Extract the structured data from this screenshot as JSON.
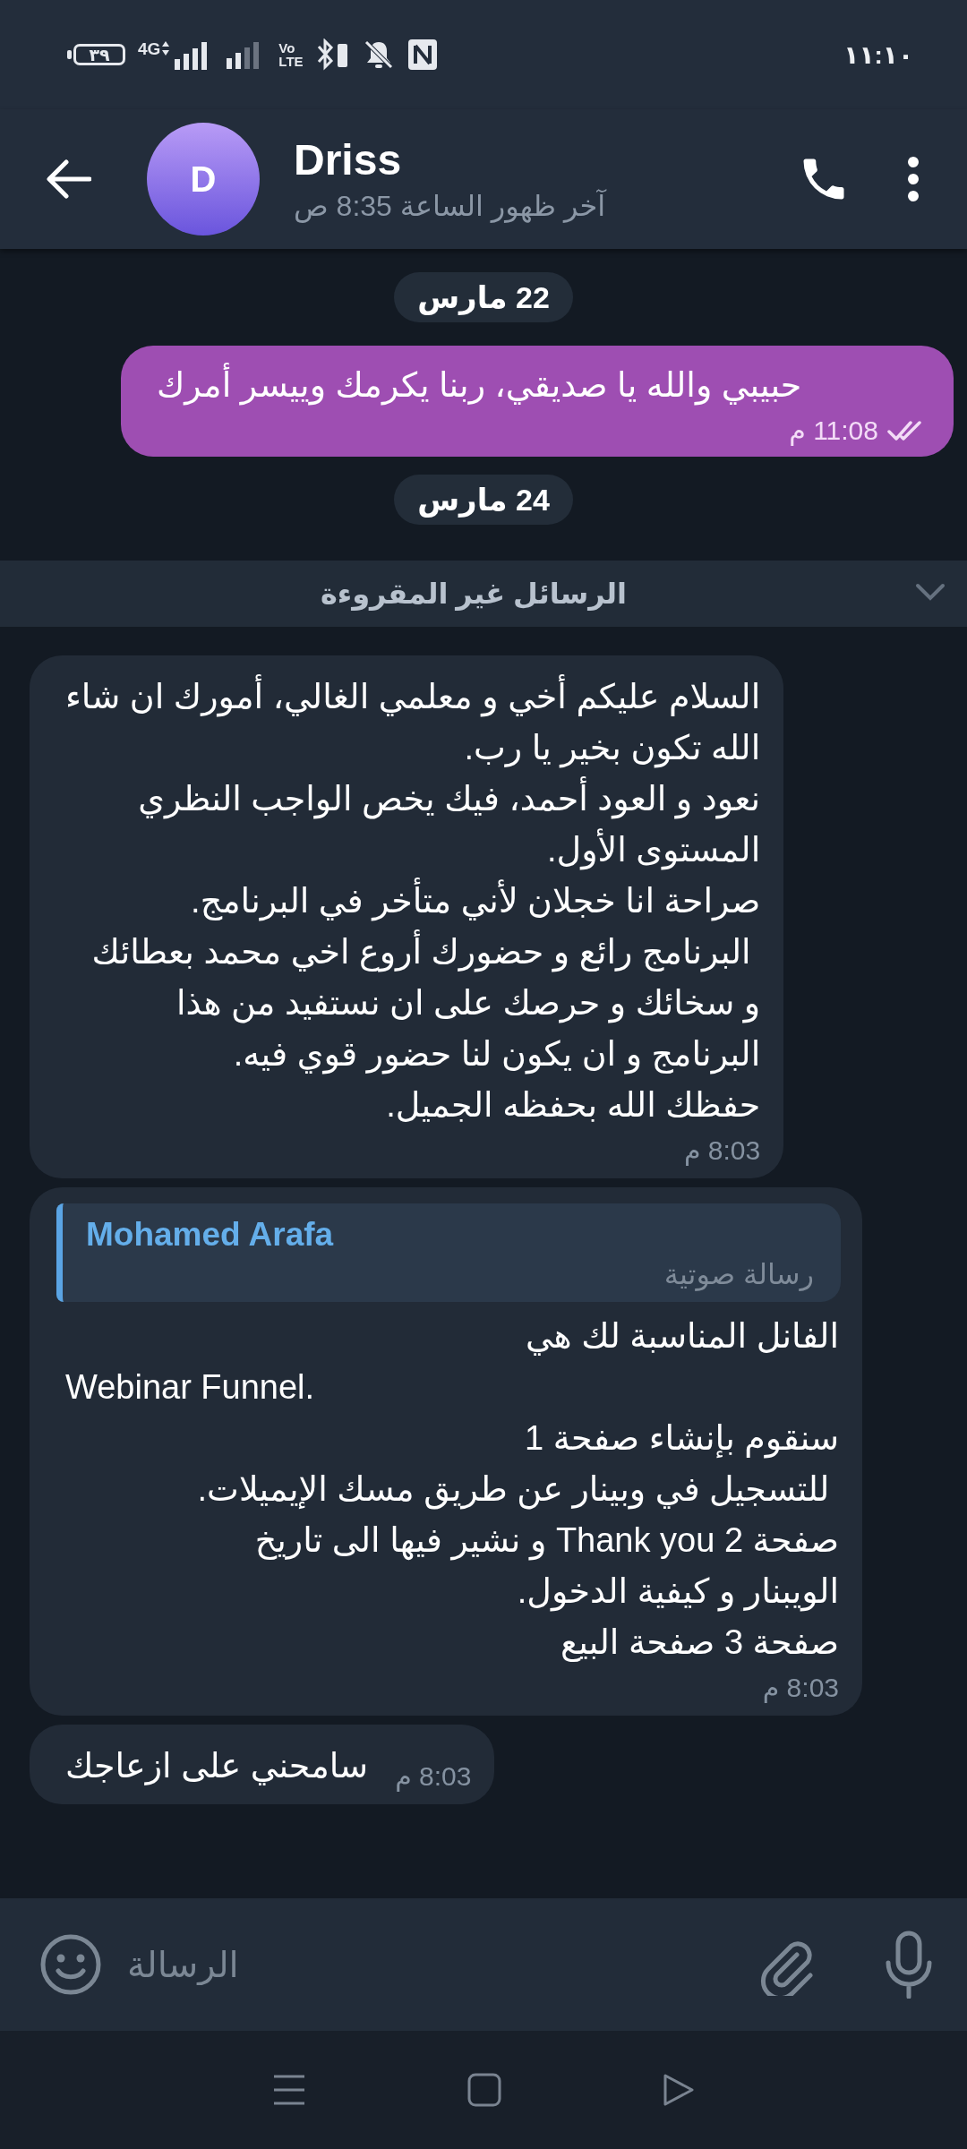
{
  "status_bar": {
    "battery": "٣٩",
    "network_type": "4G",
    "volte_top": "Vo",
    "volte_bottom": "LTE",
    "time": "١١:١٠"
  },
  "header": {
    "name": "Driss",
    "avatar_letter": "D",
    "last_seen": "آخر ظهور الساعة 8:35 ص"
  },
  "messages": [
    {
      "kind": "date",
      "text": "22 مارس"
    },
    {
      "kind": "message",
      "outgoing": true,
      "read": true,
      "text": "حبيبي والله يا صديقي، ربنا يكرمك وييسر أمرك",
      "time": "11:08 م"
    },
    {
      "kind": "date",
      "text": "24 مارس"
    },
    {
      "kind": "unread",
      "text": "الرسائل غير المقروءة"
    },
    {
      "kind": "message",
      "outgoing": false,
      "text": "السلام عليكم أخي و معلمي الغالي، أمورك ان شاء\nالله تكون بخير يا رب.\nنعود و العود أحمد، فيك يخص الواجب النظري\nالمستوى الأول.\nصراحة انا خجلان لأني متأخر في البرنامج.\n البرنامج رائع و حضورك أروع اخي محمد بعطائك\nو سخائك و حرصك على ان نستفيد من هذا\nالبرنامج و ان يكون لنا حضور قوي فيه.\nحفظك الله بحفظه الجميل.",
      "time": "8:03 م"
    },
    {
      "kind": "message",
      "outgoing": false,
      "reply": {
        "name": "Mohamed Arafa",
        "text": "رسالة صوتية"
      },
      "text": "الفانل المناسبة لك هي\nWebinar Funnel.\nسنقوم بإنشاء صفحة 1\n للتسجيل في وبينار عن طريق مسك الإيميلات.\nصفحة 2 Thank you و نشير فيها الى تاريخ\nالويبنار و كيفية الدخول.\nصفحة 3 صفحة البيع",
      "time": "8:03 م"
    },
    {
      "kind": "message",
      "outgoing": false,
      "text": "سامحني على ازعاجك",
      "time": "8:03 م"
    }
  ],
  "composer": {
    "placeholder": "الرسالة"
  }
}
